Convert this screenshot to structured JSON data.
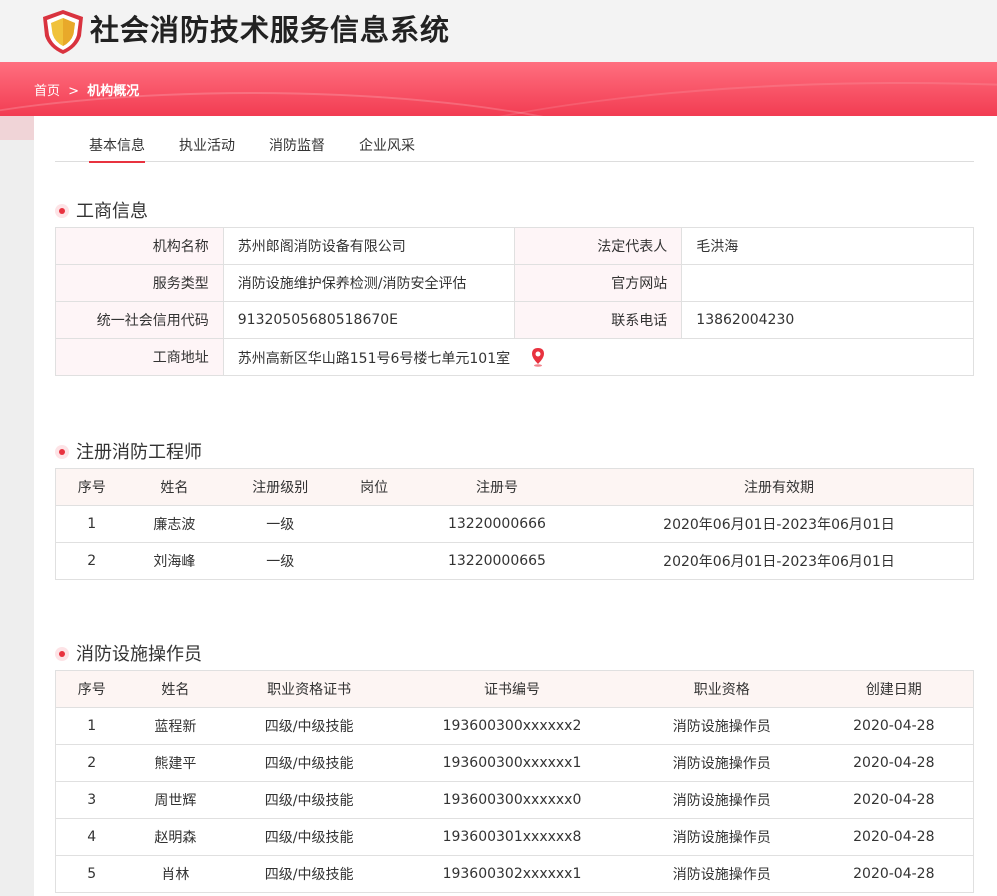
{
  "app": {
    "title": "社会消防技术服务信息系统"
  },
  "breadcrumb": {
    "home": "首页",
    "separator": ">",
    "current": "机构概况"
  },
  "tabs": [
    {
      "label": "基本信息",
      "active": true
    },
    {
      "label": "执业活动",
      "active": false
    },
    {
      "label": "消防监督",
      "active": false
    },
    {
      "label": "企业风采",
      "active": false
    }
  ],
  "business_info": {
    "title": "工商信息",
    "org_name_label": "机构名称",
    "org_name": "苏州郎阁消防设备有限公司",
    "legal_rep_label": "法定代表人",
    "legal_rep": "毛洪海",
    "service_type_label": "服务类型",
    "service_type": "消防设施维护保养检测/消防安全评估",
    "website_label": "官方网站",
    "website": "",
    "credit_code_label": "统一社会信用代码",
    "credit_code": "91320505680518670E",
    "phone_label": "联系电话",
    "phone": "13862004230",
    "address_label": "工商地址",
    "address": "苏州高新区华山路151号6号楼七单元101室"
  },
  "engineers": {
    "title": "注册消防工程师",
    "headers": [
      "序号",
      "姓名",
      "注册级别",
      "岗位",
      "注册号",
      "注册有效期"
    ],
    "rows": [
      [
        "1",
        "廉志波",
        "一级",
        "",
        "13220000666",
        "2020年06月01日-2023年06月01日"
      ],
      [
        "2",
        "刘海峰",
        "一级",
        "",
        "13220000665",
        "2020年06月01日-2023年06月01日"
      ]
    ]
  },
  "operators": {
    "title": "消防设施操作员",
    "headers": [
      "序号",
      "姓名",
      "职业资格证书",
      "证书编号",
      "职业资格",
      "创建日期"
    ],
    "rows": [
      [
        "1",
        "蓝程新",
        "四级/中级技能",
        "193600300xxxxxx2",
        "消防设施操作员",
        "2020-04-28"
      ],
      [
        "2",
        "熊建平",
        "四级/中级技能",
        "193600300xxxxxx1",
        "消防设施操作员",
        "2020-04-28"
      ],
      [
        "3",
        "周世辉",
        "四级/中级技能",
        "193600300xxxxxx0",
        "消防设施操作员",
        "2020-04-28"
      ],
      [
        "4",
        "赵明森",
        "四级/中级技能",
        "193600301xxxxxx8",
        "消防设施操作员",
        "2020-04-28"
      ],
      [
        "5",
        "肖林",
        "四级/中级技能",
        "193600302xxxxxx1",
        "消防设施操作员",
        "2020-04-28"
      ]
    ]
  },
  "colors": {
    "accent": "#e8323f",
    "banner_top": "#ff6f7f",
    "banner_bottom": "#f23c52"
  }
}
